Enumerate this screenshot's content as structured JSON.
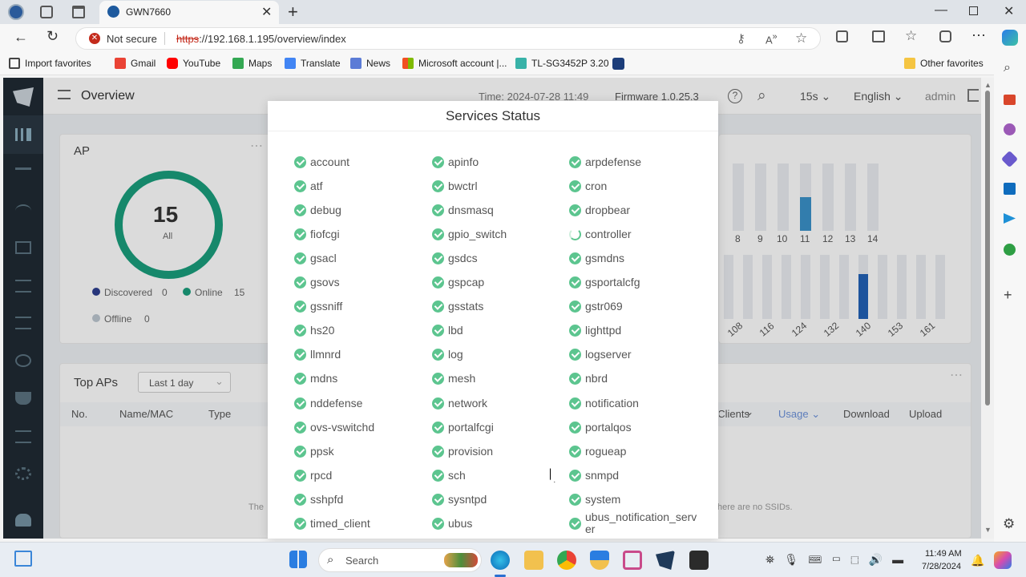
{
  "browser": {
    "tab_title": "GWN7660",
    "not_secure": "Not secure",
    "url_scheme": "https",
    "url_rest": "://192.168.1.195/overview/index",
    "favorites": [
      "Import favorites",
      "Gmail",
      "YouTube",
      "Maps",
      "Translate",
      "News",
      "Microsoft account |...",
      "TL-SG3452P 3.20"
    ],
    "other_favorites": "Other favorites"
  },
  "app": {
    "page_title": "Overview",
    "time": "Time: 2024-07-28 11:49",
    "firmware": "Firmware 1.0.25.3",
    "refresh": "15s",
    "language": "English",
    "user": "admin"
  },
  "ap_card": {
    "title": "AP",
    "total": "15",
    "total_label": "All",
    "legend": [
      {
        "label": "Discovered",
        "count": "0",
        "color": "#2d3e8c"
      },
      {
        "label": "Online",
        "count": "15",
        "color": "#1a9b7a"
      },
      {
        "label": "Offline",
        "count": "0",
        "color": "#b9c3cc"
      }
    ]
  },
  "channel_24": {
    "ticks": [
      "8",
      "9",
      "10",
      "11",
      "12",
      "13",
      "14"
    ],
    "highlight": "11"
  },
  "channel_5": {
    "ticks": [
      "108",
      "116",
      "124",
      "132",
      "140",
      "153",
      "161"
    ],
    "highlight": "153"
  },
  "top_aps": {
    "title": "Top APs",
    "range": "Last 1 day",
    "columns": [
      "No.",
      "Name/MAC",
      "Type"
    ],
    "right_columns": [
      "Clients",
      "Usage",
      "Download",
      "Upload"
    ],
    "empty_left": "The",
    "empty_right": "here are no SSIDs."
  },
  "modal": {
    "title": "Services Status",
    "columns": [
      [
        "account",
        "atf",
        "debug",
        "fiofcgi",
        "gsacl",
        "gsovs",
        "gssniff",
        "hs20",
        "llmnrd",
        "mdns",
        "nddefense",
        "ovs-vswitchd",
        "ppsk",
        "rpcd",
        "sshpfd",
        "timed_client"
      ],
      [
        "apinfo",
        "bwctrl",
        "dnsmasq",
        "gpio_switch",
        "gsdcs",
        "gspcap",
        "gsstats",
        "lbd",
        "log",
        "mesh",
        "network",
        "portalfcgi",
        "provision",
        "sch",
        "sysntpd",
        "ubus"
      ],
      [
        "arpdefense",
        "cron",
        "dropbear",
        "controller",
        "gsmdns",
        "gsportalcfg",
        "gstr069",
        "lighttpd",
        "logserver",
        "nbrd",
        "notification",
        "portalqos",
        "rogueap",
        "snmpd",
        "system",
        "ubus_notification_server"
      ]
    ],
    "pending": [
      "controller"
    ],
    "ok_color": "#5cc58f"
  },
  "taskbar": {
    "search": "Search",
    "time": "11:49 AM",
    "date": "7/28/2024"
  }
}
